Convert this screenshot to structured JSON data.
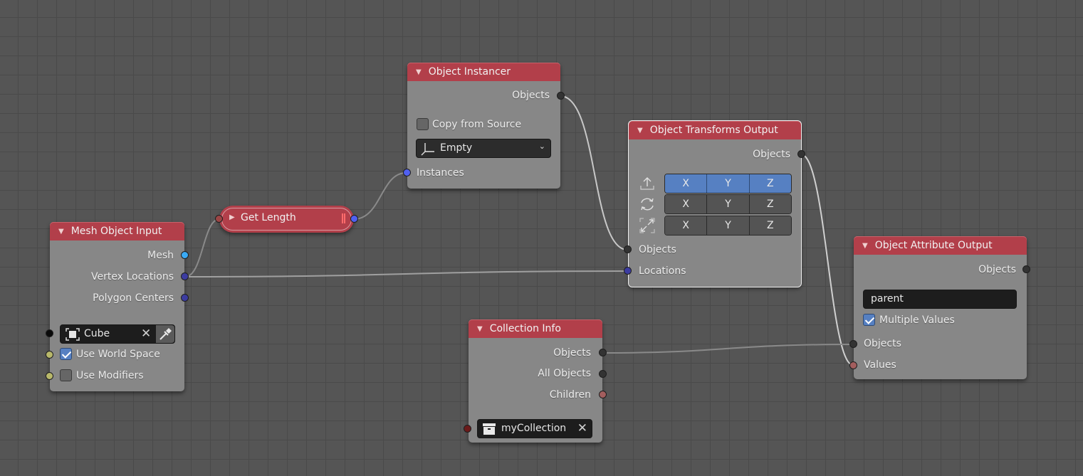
{
  "nodes": {
    "mesh_object_input": {
      "title": "Mesh Object Input",
      "outputs": [
        "Mesh",
        "Vertex Locations",
        "Polygon Centers"
      ],
      "object_field": {
        "value": "Cube",
        "icon": "mesh-cube-icon"
      },
      "use_world_space": {
        "label": "Use World Space",
        "checked": true
      },
      "use_modifiers": {
        "label": "Use Modifiers",
        "checked": false
      }
    },
    "get_length": {
      "title": "Get Length",
      "collapsed": true
    },
    "object_instancer": {
      "title": "Object Instancer",
      "outputs": [
        "Objects"
      ],
      "copy_from_source": {
        "label": "Copy from Source",
        "checked": false
      },
      "type_dropdown": {
        "value": "Empty",
        "icon": "empty-axes-icon"
      },
      "inputs": [
        "Instances"
      ]
    },
    "object_transforms_output": {
      "title": "Object Transforms Output",
      "outputs": [
        "Objects"
      ],
      "rows": [
        {
          "name": "location",
          "icon": "location-arrow-icon",
          "axes": [
            "X",
            "Y",
            "Z"
          ],
          "enabled": true
        },
        {
          "name": "rotation",
          "icon": "rotation-icon",
          "axes": [
            "X",
            "Y",
            "Z"
          ],
          "enabled": false
        },
        {
          "name": "scale",
          "icon": "scale-icon",
          "axes": [
            "X",
            "Y",
            "Z"
          ],
          "enabled": false
        }
      ],
      "inputs": [
        "Objects",
        "Locations"
      ]
    },
    "collection_info": {
      "title": "Collection Info",
      "outputs": [
        "Objects",
        "All Objects",
        "Children"
      ],
      "collection_field": {
        "value": "myCollection",
        "icon": "collection-box-icon"
      }
    },
    "object_attribute_output": {
      "title": "Object Attribute Output",
      "outputs": [
        "Objects"
      ],
      "attribute_field": {
        "value": "parent"
      },
      "multiple_values": {
        "label": "Multiple Values",
        "checked": true
      },
      "inputs": [
        "Objects",
        "Values"
      ]
    }
  },
  "colors": {
    "header": "#b23f4a",
    "node_body": "#878787",
    "background": "#555555",
    "accent_blue": "#5680c2"
  }
}
